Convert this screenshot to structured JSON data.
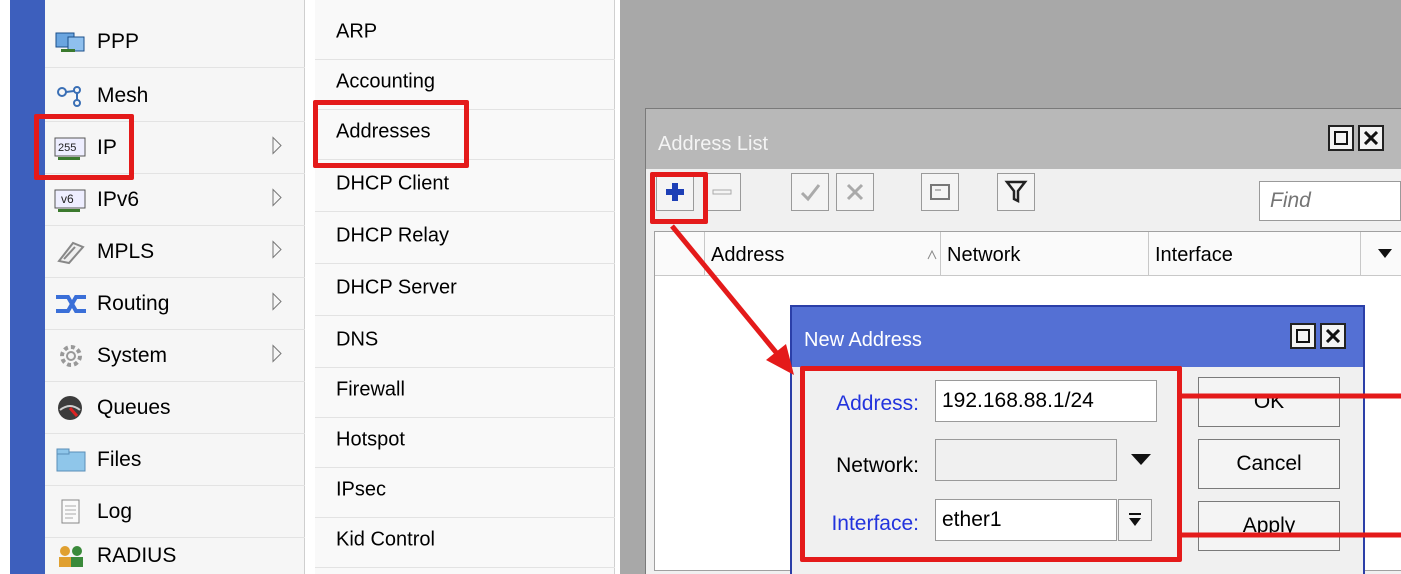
{
  "main_menu": {
    "items": [
      {
        "label": "PPP",
        "icon": "ppp-icon",
        "arrow": false
      },
      {
        "label": "Mesh",
        "icon": "mesh-icon",
        "arrow": false
      },
      {
        "label": "IP",
        "icon": "ip-icon",
        "icon_text": "255",
        "arrow": true
      },
      {
        "label": "IPv6",
        "icon": "ipv6-icon",
        "icon_text": "v6",
        "arrow": true
      },
      {
        "label": "MPLS",
        "icon": "mpls-icon",
        "arrow": true
      },
      {
        "label": "Routing",
        "icon": "routing-icon",
        "arrow": true
      },
      {
        "label": "System",
        "icon": "gear-icon",
        "arrow": true
      },
      {
        "label": "Queues",
        "icon": "queues-icon",
        "arrow": false
      },
      {
        "label": "Files",
        "icon": "folder-icon",
        "arrow": false
      },
      {
        "label": "Log",
        "icon": "log-icon",
        "arrow": false
      },
      {
        "label": "RADIUS",
        "icon": "radius-icon",
        "arrow": false
      }
    ]
  },
  "ip_submenu": {
    "items": [
      "ARP",
      "Accounting",
      "Addresses",
      "DHCP Client",
      "DHCP Relay",
      "DHCP Server",
      "DNS",
      "Firewall",
      "Hotspot",
      "IPsec",
      "Kid Control"
    ]
  },
  "address_list": {
    "title": "Address List",
    "find_placeholder": "Find",
    "columns": [
      "Address",
      "Network",
      "Interface"
    ],
    "toolbar": [
      "add-icon",
      "remove-icon",
      "enable-icon",
      "disable-icon",
      "comment-icon",
      "filter-icon"
    ]
  },
  "new_address": {
    "title": "New Address",
    "address_label": "Address:",
    "address_value": "192.168.88.1/24",
    "network_label": "Network:",
    "network_value": "",
    "interface_label": "Interface:",
    "interface_value": "ether1",
    "ok_label": "OK",
    "cancel_label": "Cancel",
    "apply_label": "Apply"
  },
  "colors": {
    "highlight": "#e41a1a",
    "label_blue": "#2233dd",
    "dialog_title": "#5470d4",
    "menu_strip": "#3d5fbd"
  }
}
